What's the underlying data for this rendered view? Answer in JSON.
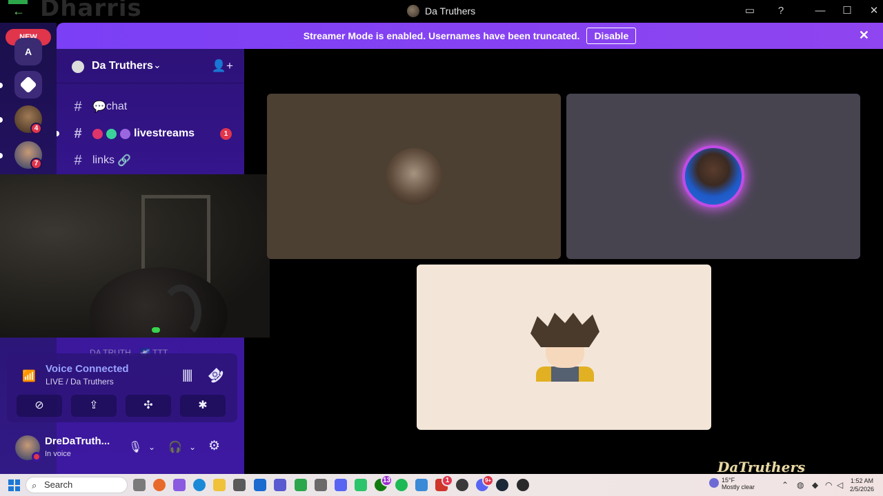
{
  "window": {
    "title": "Da Truthers",
    "ghost_logo_text": "Dharris",
    "back_glyph": "←",
    "controls": [
      "—",
      "☐",
      "✕"
    ]
  },
  "banner": {
    "text": "Streamer Mode is enabled. Usernames have been truncated.",
    "button": "Disable",
    "close_glyph": "✕"
  },
  "rail": {
    "new_badge": "NEW",
    "server_a_label": "A",
    "counts": [
      "4",
      "7"
    ]
  },
  "server": {
    "name": "Da Truthers",
    "chevron": "⌄",
    "channels": [
      {
        "name": "chat",
        "emoji": "💬",
        "unread": false
      },
      {
        "name": "livestreams",
        "unread": true,
        "mentions": "1"
      },
      {
        "name": "links",
        "emoji_after": "🔗",
        "unread": false
      }
    ],
    "faded_row": "DA TRUTH... 🌌 TTT"
  },
  "voice": {
    "title": "Voice Connected",
    "subtitle": "LIVE / Da Truthers"
  },
  "user": {
    "name": "DreDaTruth...",
    "status": "In voice"
  },
  "watermark": "DaTruthers",
  "taskbar": {
    "search": "Search",
    "weather_temp": "15°F",
    "weather_desc": "Mostly clear",
    "time": "1:52 AM",
    "date": "2/5/2026",
    "notification_badges": [
      "13",
      "1",
      "9+"
    ]
  },
  "colors": {
    "banner": "#7b3ff5",
    "sidebar": "#3a179a",
    "mention": "#e0354b",
    "voice_title": "#9aa4ff"
  }
}
